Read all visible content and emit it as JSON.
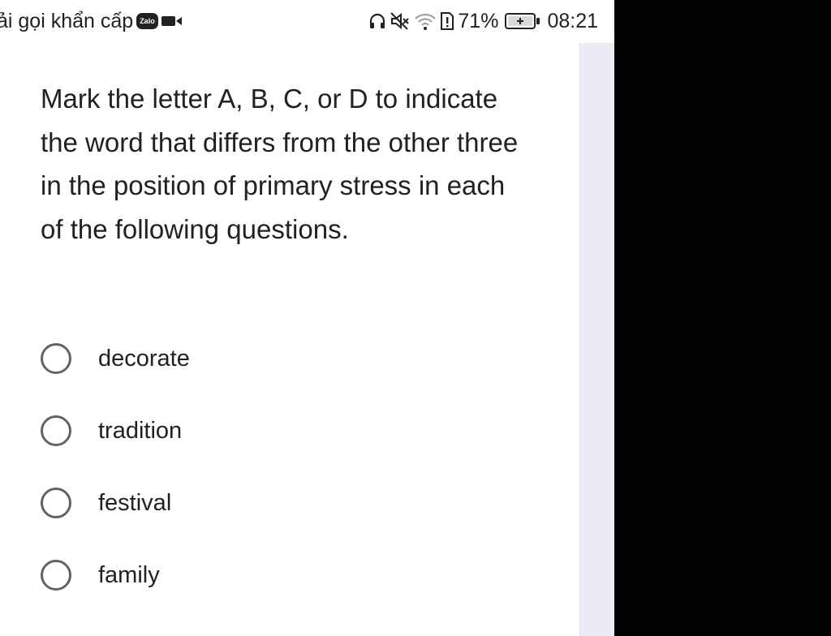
{
  "status_bar": {
    "left_text": "ải gọi khẩn cấp",
    "zalo_label": "Zalo",
    "battery_percent": "71%",
    "time": "08:21",
    "icons": [
      "headset-icon",
      "mute-icon",
      "wifi-icon",
      "sim-alert-icon",
      "battery-icon"
    ]
  },
  "question": {
    "text": "Mark the letter A, B, C, or D to indicate the word that differs from the other three in the position of primary stress in each of the following questions."
  },
  "options": [
    {
      "label": "decorate"
    },
    {
      "label": "tradition"
    },
    {
      "label": "festival"
    },
    {
      "label": "family"
    }
  ],
  "colors": {
    "background": "#ffffff",
    "side_panel": "#ede9f5",
    "text": "#202124",
    "radio_border": "#5f6368",
    "outside": "#000000"
  }
}
